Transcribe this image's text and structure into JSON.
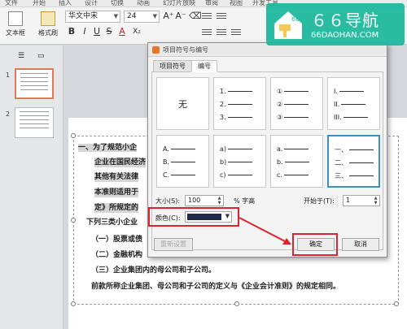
{
  "ribbon": {
    "tabs": [
      "文件",
      "开始",
      "插入",
      "设计",
      "切换",
      "动画",
      "幻灯片放映",
      "审阅",
      "视图",
      "开发工具"
    ],
    "textbox_label": "文本框",
    "format_painter_label": "格式刷",
    "font_name": "华文中宋",
    "font_size": "24",
    "bold": "B",
    "italic": "I",
    "underline": "U",
    "strike": "S",
    "font_color": "A",
    "subscript": "X₂",
    "grow_font": "A⁺",
    "shrink_font": "A⁻"
  },
  "slides_panel": {
    "thumbs": [
      {
        "num": "1"
      },
      {
        "num": "2"
      }
    ]
  },
  "slide": {
    "lines": [
      "一、为了规范小企",
      "企业在国民经济",
      "其他有关法律",
      "本准则适用于",
      "定》所规定的",
      "下列三类小企业",
      "（一）股票或债",
      "（二）金融机构",
      "（三）企业集团内的母公司和子公司。",
      "前款所称企业集团、母公司和子公司的定义与《企业会计准则》的规定相同。"
    ]
  },
  "dialog": {
    "title": "项目符号与编号",
    "tabs": [
      "项目符号",
      "编号"
    ],
    "active_tab": "编号",
    "styles": [
      {
        "kind": "none",
        "label": "无"
      },
      {
        "kind": "list",
        "markers": [
          "1.",
          "2.",
          "3."
        ]
      },
      {
        "kind": "list",
        "markers": [
          "①",
          "②",
          "③"
        ]
      },
      {
        "kind": "list",
        "markers": [
          "I.",
          "II.",
          "III."
        ]
      },
      {
        "kind": "list",
        "markers": [
          "A.",
          "B.",
          "C."
        ]
      },
      {
        "kind": "list",
        "markers": [
          "a)",
          "b)",
          "c)"
        ]
      },
      {
        "kind": "list",
        "markers": [
          "a.",
          "b.",
          "c."
        ]
      },
      {
        "kind": "list",
        "markers": [
          "一、",
          "二、",
          "三、"
        ]
      }
    ],
    "selected_style": "一、",
    "size_label": "大小(S):",
    "size_value": "100",
    "size_unit": "% 字高",
    "start_label": "开始于(T):",
    "start_value": "1",
    "color_label": "颜色(C):",
    "color_value": "#22284a",
    "reset_label": "重新设置",
    "ok_label": "确定",
    "cancel_label": "取消"
  },
  "watermark": {
    "title": "６６导航",
    "url": "66DAOHAN.COM"
  },
  "colors": {
    "annotation_red": "#d8252f",
    "watermark_green": "#19b89c",
    "thumb_selected": "#e07a4f",
    "style_selected": "#3b8fc8"
  }
}
